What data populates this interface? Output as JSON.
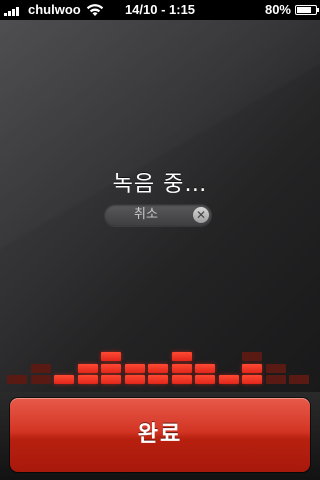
{
  "status_bar": {
    "carrier": "chulwoo",
    "clock": "14/10 - 1:15",
    "battery_pct": "80%",
    "battery_level": 0.8,
    "signal_bars": 4,
    "icons": [
      "signal-icon",
      "wifi-icon",
      "battery-icon"
    ]
  },
  "recording": {
    "title": "녹음 중…",
    "cancel_label": "취소",
    "cancel_icon": "close-icon"
  },
  "equalizer": {
    "colors": {
      "lit": "#e0261a",
      "dim": "#5a1a14"
    },
    "max_cells": 4,
    "columns": [
      {
        "lit": 0,
        "height": 1
      },
      {
        "lit": 0,
        "height": 2
      },
      {
        "lit": 1,
        "height": 1
      },
      {
        "lit": 2,
        "height": 2
      },
      {
        "lit": 3,
        "height": 3
      },
      {
        "lit": 2,
        "height": 2
      },
      {
        "lit": 2,
        "height": 2
      },
      {
        "lit": 3,
        "height": 3
      },
      {
        "lit": 2,
        "height": 2
      },
      {
        "lit": 1,
        "height": 1
      },
      {
        "lit": 2,
        "height": 3
      },
      {
        "lit": 0,
        "height": 2
      },
      {
        "lit": 0,
        "height": 1
      }
    ]
  },
  "footer": {
    "done_label": "완료",
    "accent": "#d33524"
  }
}
